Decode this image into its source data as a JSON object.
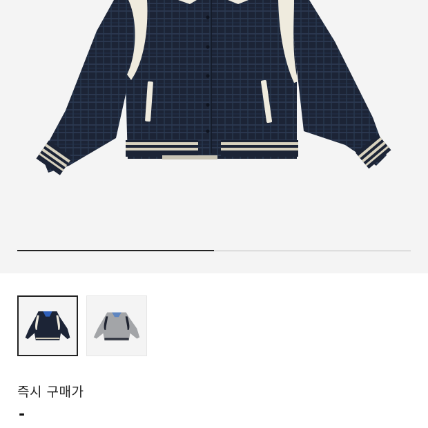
{
  "product": {
    "image_alt": "Jacket",
    "thumbnails": [
      {
        "name": "navy-plaid-jacket",
        "selected": true
      },
      {
        "name": "grey-jacket",
        "selected": false
      }
    ],
    "gallery_progress": 0.5
  },
  "price": {
    "label": "즉시 구매가",
    "value": "-"
  },
  "colors": {
    "navy": "#1c2436",
    "cream": "#efebde",
    "grey": "#a3a5a8",
    "background": "#f4f4f4"
  }
}
